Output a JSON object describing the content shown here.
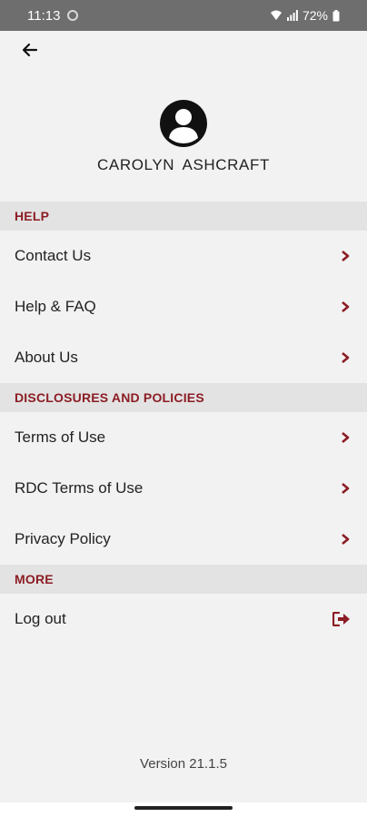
{
  "status_bar": {
    "time": "11:13",
    "battery": "72%"
  },
  "profile": {
    "name": "CAROLYN  ASHCRAFT"
  },
  "sections": {
    "help": {
      "title": "HELP",
      "items": [
        "Contact Us",
        "Help & FAQ",
        "About Us"
      ]
    },
    "disclosures": {
      "title": "DISCLOSURES AND POLICIES",
      "items": [
        "Terms of Use",
        "RDC Terms of Use",
        "Privacy Policy"
      ]
    },
    "more": {
      "title": "MORE",
      "items": [
        "Log out"
      ]
    }
  },
  "footer": {
    "version": "Version 21.1.5"
  },
  "colors": {
    "accent": "#8c1d24",
    "section_bg": "#e3e3e3",
    "page_bg": "#f2f2f2"
  },
  "icons": {
    "back": "arrow-left-icon",
    "row": "chevron-right-icon",
    "logout": "logout-icon",
    "avatar": "user-avatar-icon"
  }
}
